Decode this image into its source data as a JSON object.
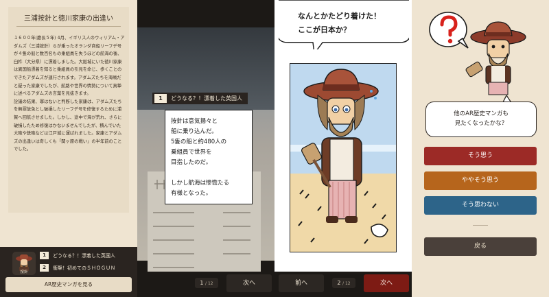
{
  "colors": {
    "cream": "#efe4d1",
    "dark": "#2a2420",
    "opt_agree": "#9c2a26",
    "opt_somewhat": "#b6651c",
    "opt_disagree": "#2d6489",
    "back": "#4a403a",
    "next_active": "#7d1b14"
  },
  "article": {
    "title": "三浦按針と徳川家康の出逢い",
    "paragraphs": [
      "１６００年(慶長５年) 4月、イギリス人のウィリアム・アダムズ（三浦按針）らが乗ったオランダ商船リーフデ号が４隻の船と数百名もの乗組員を失うほどの航海の後、臼杵（大分県）に漂着しました。大阪城にいた徳川家康は異国船漂着を知ると乗組員の引見を命じ、歩くことのできたアダムズが連行されます。アダムズたちを海賊だと疑った家康でしたが、航路や世界の情勢について真摯に述べるアダムズの言葉を見抜きます。",
      "詮議の結果、罪はないと判断した家康は、アダムズたちを無罪放免とし破損したリーフデ号を修復するために浦賀へ回航させました。しかし、途中で海が荒れ、さらに破損したため修復はかないませんでしたが、積んでいた大砲や鉄砲などは江戸城に運ばれました。家康とアダムズの出逢いは奇しくも「関ヶ原の戦い」の半年前のことでした。"
    ]
  },
  "dock": {
    "avatar_label": "按針",
    "episodes": [
      {
        "num": "1",
        "title": "どうなる？！漂着した英国人"
      },
      {
        "num": "2",
        "title": "衝撃！初めてのＳＨＯＧＵＮ"
      }
    ],
    "ar_button": "AR歴史マンガを見る"
  },
  "manga1": {
    "badge_num": "1",
    "badge_title": "どうなる？！漂着した英国人",
    "caption_lines": [
      "按針は意気揚々と",
      "船に乗り込んだ。",
      "5隻の船と約480人の",
      "乗組員で世界を",
      "目指したのだ。"
    ],
    "caption_lines2": [
      "しかし航海は惨憺たる",
      "有様となった。"
    ],
    "page": "1",
    "total": "/ 12",
    "next": "次へ"
  },
  "manga2": {
    "speech_lines": [
      "なんとかたどり着けた！",
      "ここが日本か？"
    ],
    "page": "2",
    "total": "/ 12",
    "prev": "前へ",
    "next": "次へ"
  },
  "survey": {
    "prompt_lines": [
      "他のAR歴史マンガも",
      "見たくなったかな？"
    ],
    "options": [
      "そう思う",
      "ややそう思う",
      "そう思わない"
    ],
    "back": "戻る"
  }
}
